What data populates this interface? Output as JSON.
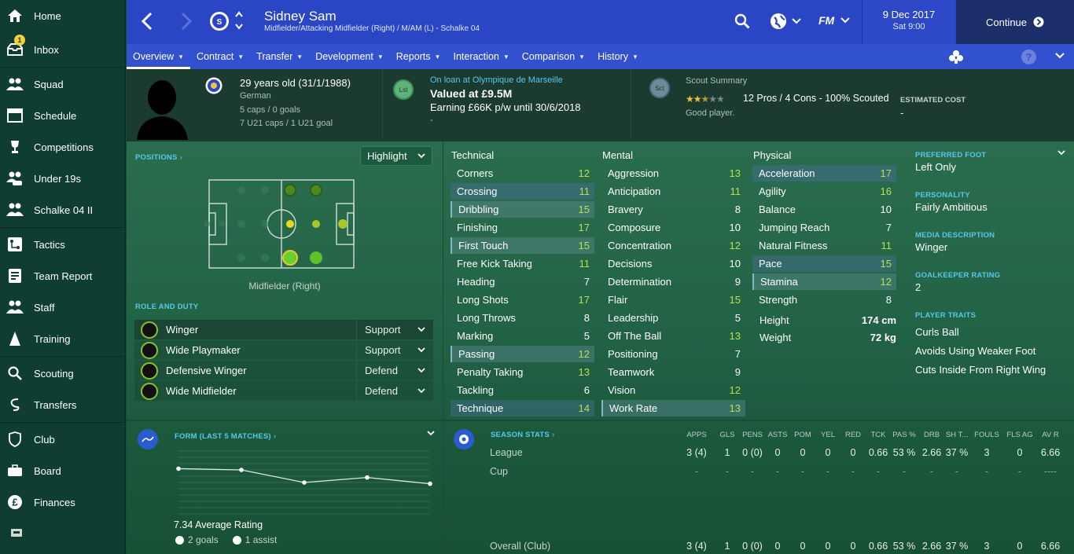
{
  "sidebar": {
    "items": [
      {
        "label": "Home",
        "icon": "home-icon"
      },
      {
        "label": "Inbox",
        "icon": "inbox-icon",
        "badge": "1"
      },
      {
        "label": "Squad",
        "icon": "squad-icon"
      },
      {
        "label": "Schedule",
        "icon": "schedule-icon"
      },
      {
        "label": "Competitions",
        "icon": "trophy-icon"
      },
      {
        "label": "Under 19s",
        "icon": "u19-icon"
      },
      {
        "label": "Schalke 04 II",
        "icon": "reserves-icon"
      },
      {
        "label": "Tactics",
        "icon": "tactics-icon"
      },
      {
        "label": "Team Report",
        "icon": "report-icon"
      },
      {
        "label": "Staff",
        "icon": "staff-icon"
      },
      {
        "label": "Training",
        "icon": "training-icon"
      },
      {
        "label": "Scouting",
        "icon": "search-icon"
      },
      {
        "label": "Transfers",
        "icon": "transfers-icon"
      },
      {
        "label": "Club",
        "icon": "shield-icon"
      },
      {
        "label": "Board",
        "icon": "board-icon"
      },
      {
        "label": "Finances",
        "icon": "pound-icon"
      }
    ]
  },
  "topbar": {
    "player_name": "Sidney Sam",
    "player_subtitle": "Midfielder/Attacking Midfielder (Right) / M/AM (L) - Schalke 04",
    "date": "9 Dec 2017",
    "time": "Sat 9:00",
    "continue_label": "Continue"
  },
  "nav": {
    "tabs": [
      "Overview",
      "Contract",
      "Transfer",
      "Development",
      "Reports",
      "Interaction",
      "Comparison",
      "History"
    ]
  },
  "header": {
    "age": "29 years old (31/1/1988)",
    "nationality": "German",
    "caps": "5 caps / 0 goals",
    "u21_caps": "7 U21 caps / 1 U21 goal",
    "loan_badge": "Lst",
    "loan_text": "On loan at Olympique de Marseille",
    "value": "Valued at £9.5M",
    "earning": "Earning £66K p/w until 30/6/2018",
    "dash": "-",
    "scout_badge": "Sct",
    "scout_title": "Scout Summary",
    "scout_rating_stars": 2.5,
    "scout_text": "12 Pros / 4 Cons - 100% Scouted",
    "scout_desc": "Good player.",
    "estimated_cost_label": "ESTIMATED COST",
    "estimated_cost_value": "-"
  },
  "positions": {
    "label": "POSITIONS",
    "highlight_label": "Highlight",
    "position_name": "Midfielder (Right)"
  },
  "role_duty": {
    "label": "ROLE AND DUTY",
    "roles": [
      {
        "role": "Winger",
        "duty": "Support"
      },
      {
        "role": "Wide Playmaker",
        "duty": "Support"
      },
      {
        "role": "Defensive Winger",
        "duty": "Defend"
      },
      {
        "role": "Wide Midfielder",
        "duty": "Defend"
      }
    ]
  },
  "attributes": {
    "technical_label": "Technical",
    "mental_label": "Mental",
    "physical_label": "Physical",
    "technical": [
      {
        "name": "Corners",
        "value": "12"
      },
      {
        "name": "Crossing",
        "value": "11"
      },
      {
        "name": "Dribbling",
        "value": "15"
      },
      {
        "name": "Finishing",
        "value": "17"
      },
      {
        "name": "First Touch",
        "value": "15"
      },
      {
        "name": "Free Kick Taking",
        "value": "11"
      },
      {
        "name": "Heading",
        "value": "7"
      },
      {
        "name": "Long Shots",
        "value": "17"
      },
      {
        "name": "Long Throws",
        "value": "8"
      },
      {
        "name": "Marking",
        "value": "5"
      },
      {
        "name": "Passing",
        "value": "12"
      },
      {
        "name": "Penalty Taking",
        "value": "13"
      },
      {
        "name": "Tackling",
        "value": "6"
      },
      {
        "name": "Technique",
        "value": "14"
      }
    ],
    "mental": [
      {
        "name": "Aggression",
        "value": "13"
      },
      {
        "name": "Anticipation",
        "value": "11"
      },
      {
        "name": "Bravery",
        "value": "8"
      },
      {
        "name": "Composure",
        "value": "10"
      },
      {
        "name": "Concentration",
        "value": "12"
      },
      {
        "name": "Decisions",
        "value": "10"
      },
      {
        "name": "Determination",
        "value": "9"
      },
      {
        "name": "Flair",
        "value": "15"
      },
      {
        "name": "Leadership",
        "value": "5"
      },
      {
        "name": "Off The Ball",
        "value": "13"
      },
      {
        "name": "Positioning",
        "value": "7"
      },
      {
        "name": "Teamwork",
        "value": "9"
      },
      {
        "name": "Vision",
        "value": "12"
      },
      {
        "name": "Work Rate",
        "value": "13"
      }
    ],
    "physical": [
      {
        "name": "Acceleration",
        "value": "17"
      },
      {
        "name": "Agility",
        "value": "16"
      },
      {
        "name": "Balance",
        "value": "10"
      },
      {
        "name": "Jumping Reach",
        "value": "7"
      },
      {
        "name": "Natural Fitness",
        "value": "11"
      },
      {
        "name": "Pace",
        "value": "15"
      },
      {
        "name": "Stamina",
        "value": "12"
      },
      {
        "name": "Strength",
        "value": "8"
      }
    ],
    "height_label": "Height",
    "height": "174 cm",
    "weight_label": "Weight",
    "weight": "72 kg"
  },
  "info": {
    "preferred_foot_label": "PREFERRED FOOT",
    "preferred_foot": "Left Only",
    "personality_label": "PERSONALITY",
    "personality": "Fairly Ambitious",
    "media_label": "MEDIA DESCRIPTION",
    "media": "Winger",
    "gk_label": "GOALKEEPER RATING",
    "gk": "2",
    "traits_label": "PLAYER TRAITS",
    "traits": [
      "Curls Ball",
      "Avoids Using Weaker Foot",
      "Cuts Inside From Right Wing"
    ]
  },
  "form": {
    "label": "FORM (LAST 5 MATCHES)",
    "avg": "7.34 Average Rating",
    "goals": "2 goals",
    "assists": "1 assist",
    "ratings_relative": [
      0.72,
      0.7,
      0.5,
      0.58,
      0.48
    ]
  },
  "season": {
    "label": "SEASON STATS",
    "headers": [
      "APPS",
      "GLS",
      "PENS",
      "ASTS",
      "POM",
      "YEL",
      "RED",
      "TCK",
      "PAS %",
      "DRB",
      "SH T...",
      "FOULS",
      "FLS AG",
      "AV R"
    ],
    "rows": [
      {
        "label": "League",
        "values": [
          "3 (4)",
          "1",
          "0 (0)",
          "0",
          "0",
          "0",
          "0",
          "0.66",
          "53 %",
          "2.66",
          "37 %",
          "3",
          "0",
          "6.66"
        ]
      },
      {
        "label": "Cup",
        "values": [
          "-",
          "-",
          "-",
          "-",
          "-",
          "-",
          "-",
          "-",
          "-",
          "-",
          "-",
          "-",
          "-",
          "----"
        ]
      },
      {
        "label": "Overall (Club)",
        "values": [
          "3 (4)",
          "1",
          "0 (0)",
          "0",
          "0",
          "0",
          "0",
          "0.66",
          "53 %",
          "2.66",
          "37 %",
          "3",
          "0",
          "6.66"
        ]
      }
    ]
  },
  "colors": {
    "accent": "#2a46c4",
    "positive": "#b8e04a",
    "link": "#59c7ea"
  }
}
